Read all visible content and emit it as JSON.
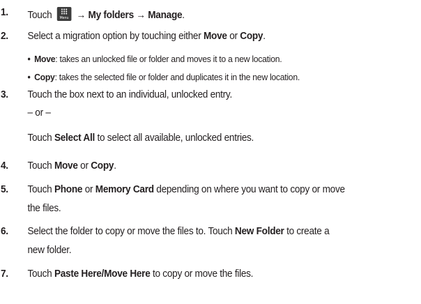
{
  "steps": [
    {
      "num": "1.",
      "pre": "Touch",
      "icon": {
        "name": "menu-icon",
        "caption": "Menu"
      },
      "path1": "→ My folders → Manage",
      "post": "."
    },
    {
      "num": "2.",
      "pre": "Select a migration option by touching either ",
      "b1": "Move",
      "mid": " or ",
      "b2": "Copy",
      "post": ".",
      "bullets": [
        {
          "term": "Move",
          "desc": ": takes an unlocked file or folder and moves it to a new location."
        },
        {
          "term": "Copy",
          "desc": ": takes the selected file or folder and duplicates it in the new location."
        }
      ]
    },
    {
      "num": "3.",
      "line1": "Touch the box next to an individual, unlocked entry.",
      "or": "– or –",
      "pre": "Touch ",
      "b1": "Select All",
      "post": " to select all available, unlocked entries."
    },
    {
      "num": "4.",
      "pre": "Touch ",
      "b1": "Move",
      "mid": " or ",
      "b2": "Copy",
      "post": "."
    },
    {
      "num": "5.",
      "pre": "Touch ",
      "b1": "Phone",
      "mid": " or ",
      "b2": "Memory Card",
      "post": " depending on where you want to copy or move",
      "cont": "the files."
    },
    {
      "num": "6.",
      "pre": "Select the folder to copy or move the files to. Touch ",
      "b1": "New Folder",
      "post": " to create a",
      "cont": "new folder."
    },
    {
      "num": "7.",
      "pre": "Touch ",
      "b1": "Paste Here/Move Here",
      "post": " to copy or move the files."
    }
  ]
}
